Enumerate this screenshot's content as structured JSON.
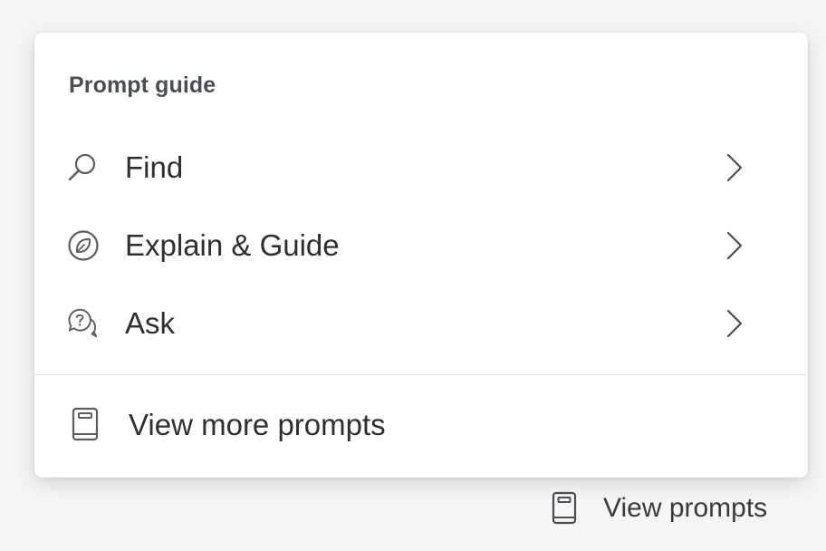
{
  "prompt_guide": {
    "title": "Prompt guide",
    "items": [
      {
        "label": "Find",
        "icon": "search-icon"
      },
      {
        "label": "Explain & Guide",
        "icon": "leaf-circle-icon"
      },
      {
        "label": "Ask",
        "icon": "question-chat-icon"
      }
    ],
    "footer": {
      "label": "View more prompts",
      "icon": "book-icon"
    }
  },
  "toolbar": {
    "view_prompts_label": "View prompts",
    "view_prompts_icon": "book-icon"
  },
  "colors": {
    "background": "#f6f6f6",
    "panel": "#ffffff",
    "text": "#2f2f2f",
    "title": "#4a4d52",
    "icon": "#5a5d62"
  }
}
